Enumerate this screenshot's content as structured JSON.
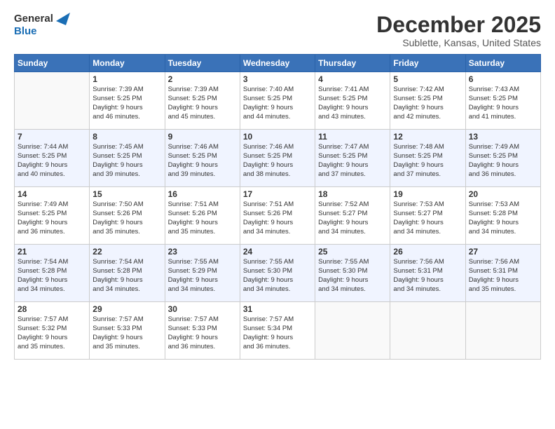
{
  "logo": {
    "line1": "General",
    "line2": "Blue"
  },
  "title": "December 2025",
  "subtitle": "Sublette, Kansas, United States",
  "weekdays": [
    "Sunday",
    "Monday",
    "Tuesday",
    "Wednesday",
    "Thursday",
    "Friday",
    "Saturday"
  ],
  "weeks": [
    [
      {
        "day": "",
        "info": ""
      },
      {
        "day": "1",
        "info": "Sunrise: 7:39 AM\nSunset: 5:25 PM\nDaylight: 9 hours\nand 46 minutes."
      },
      {
        "day": "2",
        "info": "Sunrise: 7:39 AM\nSunset: 5:25 PM\nDaylight: 9 hours\nand 45 minutes."
      },
      {
        "day": "3",
        "info": "Sunrise: 7:40 AM\nSunset: 5:25 PM\nDaylight: 9 hours\nand 44 minutes."
      },
      {
        "day": "4",
        "info": "Sunrise: 7:41 AM\nSunset: 5:25 PM\nDaylight: 9 hours\nand 43 minutes."
      },
      {
        "day": "5",
        "info": "Sunrise: 7:42 AM\nSunset: 5:25 PM\nDaylight: 9 hours\nand 42 minutes."
      },
      {
        "day": "6",
        "info": "Sunrise: 7:43 AM\nSunset: 5:25 PM\nDaylight: 9 hours\nand 41 minutes."
      }
    ],
    [
      {
        "day": "7",
        "info": "Sunrise: 7:44 AM\nSunset: 5:25 PM\nDaylight: 9 hours\nand 40 minutes."
      },
      {
        "day": "8",
        "info": "Sunrise: 7:45 AM\nSunset: 5:25 PM\nDaylight: 9 hours\nand 39 minutes."
      },
      {
        "day": "9",
        "info": "Sunrise: 7:46 AM\nSunset: 5:25 PM\nDaylight: 9 hours\nand 39 minutes."
      },
      {
        "day": "10",
        "info": "Sunrise: 7:46 AM\nSunset: 5:25 PM\nDaylight: 9 hours\nand 38 minutes."
      },
      {
        "day": "11",
        "info": "Sunrise: 7:47 AM\nSunset: 5:25 PM\nDaylight: 9 hours\nand 37 minutes."
      },
      {
        "day": "12",
        "info": "Sunrise: 7:48 AM\nSunset: 5:25 PM\nDaylight: 9 hours\nand 37 minutes."
      },
      {
        "day": "13",
        "info": "Sunrise: 7:49 AM\nSunset: 5:25 PM\nDaylight: 9 hours\nand 36 minutes."
      }
    ],
    [
      {
        "day": "14",
        "info": "Sunrise: 7:49 AM\nSunset: 5:25 PM\nDaylight: 9 hours\nand 36 minutes."
      },
      {
        "day": "15",
        "info": "Sunrise: 7:50 AM\nSunset: 5:26 PM\nDaylight: 9 hours\nand 35 minutes."
      },
      {
        "day": "16",
        "info": "Sunrise: 7:51 AM\nSunset: 5:26 PM\nDaylight: 9 hours\nand 35 minutes."
      },
      {
        "day": "17",
        "info": "Sunrise: 7:51 AM\nSunset: 5:26 PM\nDaylight: 9 hours\nand 34 minutes."
      },
      {
        "day": "18",
        "info": "Sunrise: 7:52 AM\nSunset: 5:27 PM\nDaylight: 9 hours\nand 34 minutes."
      },
      {
        "day": "19",
        "info": "Sunrise: 7:53 AM\nSunset: 5:27 PM\nDaylight: 9 hours\nand 34 minutes."
      },
      {
        "day": "20",
        "info": "Sunrise: 7:53 AM\nSunset: 5:28 PM\nDaylight: 9 hours\nand 34 minutes."
      }
    ],
    [
      {
        "day": "21",
        "info": "Sunrise: 7:54 AM\nSunset: 5:28 PM\nDaylight: 9 hours\nand 34 minutes."
      },
      {
        "day": "22",
        "info": "Sunrise: 7:54 AM\nSunset: 5:28 PM\nDaylight: 9 hours\nand 34 minutes."
      },
      {
        "day": "23",
        "info": "Sunrise: 7:55 AM\nSunset: 5:29 PM\nDaylight: 9 hours\nand 34 minutes."
      },
      {
        "day": "24",
        "info": "Sunrise: 7:55 AM\nSunset: 5:30 PM\nDaylight: 9 hours\nand 34 minutes."
      },
      {
        "day": "25",
        "info": "Sunrise: 7:55 AM\nSunset: 5:30 PM\nDaylight: 9 hours\nand 34 minutes."
      },
      {
        "day": "26",
        "info": "Sunrise: 7:56 AM\nSunset: 5:31 PM\nDaylight: 9 hours\nand 34 minutes."
      },
      {
        "day": "27",
        "info": "Sunrise: 7:56 AM\nSunset: 5:31 PM\nDaylight: 9 hours\nand 35 minutes."
      }
    ],
    [
      {
        "day": "28",
        "info": "Sunrise: 7:57 AM\nSunset: 5:32 PM\nDaylight: 9 hours\nand 35 minutes."
      },
      {
        "day": "29",
        "info": "Sunrise: 7:57 AM\nSunset: 5:33 PM\nDaylight: 9 hours\nand 35 minutes."
      },
      {
        "day": "30",
        "info": "Sunrise: 7:57 AM\nSunset: 5:33 PM\nDaylight: 9 hours\nand 36 minutes."
      },
      {
        "day": "31",
        "info": "Sunrise: 7:57 AM\nSunset: 5:34 PM\nDaylight: 9 hours\nand 36 minutes."
      },
      {
        "day": "",
        "info": ""
      },
      {
        "day": "",
        "info": ""
      },
      {
        "day": "",
        "info": ""
      }
    ]
  ]
}
